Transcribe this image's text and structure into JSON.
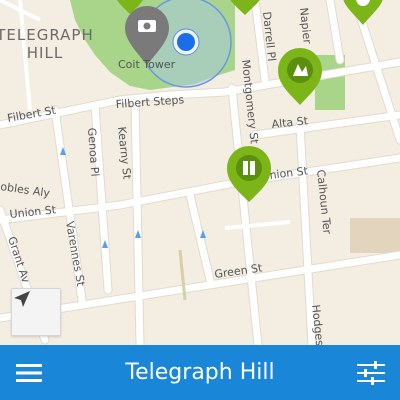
{
  "map": {
    "district_label": [
      "TELEGRAPH",
      "HILL"
    ],
    "landmark_label": "Coit Tower",
    "streets": {
      "filbert": "Filbert St",
      "filbert_steps": "Filbert Steps",
      "alta": "Alta St",
      "union_left": "Union St",
      "union_right": "Union St",
      "green": "Green St",
      "varennes": "Varennes St",
      "grant": "Grant Av",
      "genoa": "Genoa Pl",
      "kearny": "Kearny St",
      "montgomery": "Montgomery St",
      "calhoun": "Calhoun Ter",
      "darrell": "Darrell Pl",
      "napier": "Napier",
      "hodges": "Hodges",
      "bobles": "obles Aly"
    },
    "markers": [
      {
        "name": "marker-coit-tower",
        "color": "#7a7a7a",
        "icon": "scenic-icon"
      },
      {
        "name": "marker-top",
        "color": "#7cb518",
        "icon": "poi-icon"
      },
      {
        "name": "marker-garden",
        "color": "#7cb518",
        "icon": "garden-icon"
      },
      {
        "name": "marker-union",
        "color": "#7cb518",
        "icon": "book-icon"
      },
      {
        "name": "marker-top-right",
        "color": "#7cb518",
        "icon": "poi-icon"
      }
    ],
    "colors": {
      "land": "#f3ede2",
      "park": "#a8d58a",
      "road": "#ffffff",
      "marker_green": "#7cb518",
      "user_location": "#1a6fe8"
    }
  },
  "controls": {
    "locate_icon": "navigation-arrow-icon"
  },
  "bottom_bar": {
    "title": "Telegraph Hill",
    "menu_icon": "hamburger-menu-icon",
    "filter_icon": "sliders-icon",
    "color": "#1a86d8"
  }
}
